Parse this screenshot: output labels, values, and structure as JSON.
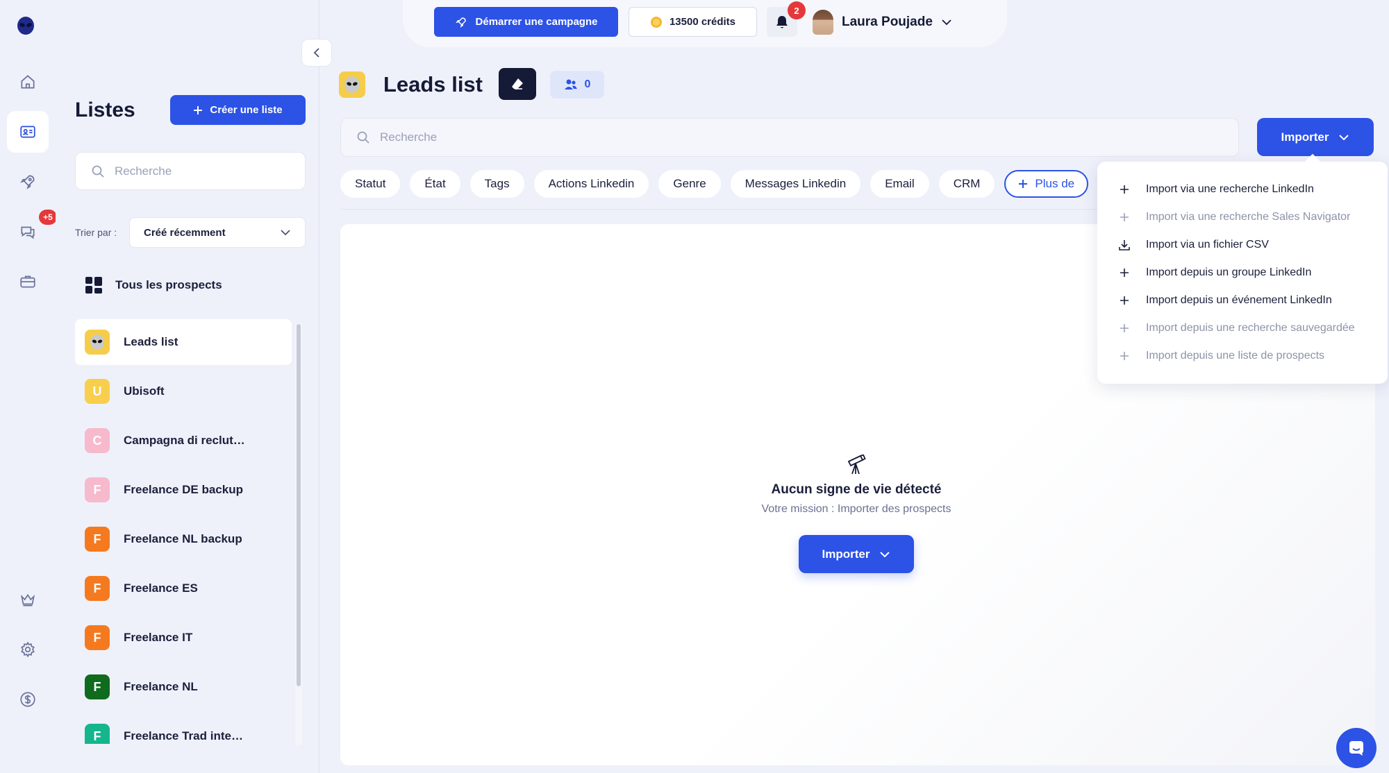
{
  "topbar": {
    "campaign_label": "Démarrer une campagne",
    "credits_label": "13500 crédits",
    "notifications_count": "2",
    "user_name": "Laura Poujade"
  },
  "rail": {
    "items": [
      {
        "icon": "home-icon"
      },
      {
        "icon": "contacts-icon",
        "active": true
      },
      {
        "icon": "rocket-icon"
      },
      {
        "icon": "messages-icon",
        "badge": "+5"
      },
      {
        "icon": "briefcase-icon"
      },
      {
        "icon": "crown-icon"
      },
      {
        "icon": "gear-icon"
      },
      {
        "icon": "dollar-icon"
      }
    ]
  },
  "panel": {
    "title": "Listes",
    "create_label": "Créer une liste",
    "search_placeholder": "Recherche",
    "sort_label": "Trier par :",
    "sort_value": "Créé récemment",
    "all_prospects": "Tous les prospects",
    "lists": [
      {
        "name": "Leads list",
        "letter": "",
        "color": "#f5cd4a",
        "active": true
      },
      {
        "name": "Ubisoft",
        "letter": "U",
        "color": "#f8cf4c"
      },
      {
        "name": "Campagna di reclut…",
        "letter": "C",
        "color": "#f7b9cc"
      },
      {
        "name": "Freelance DE backup",
        "letter": "F",
        "color": "#f7b9cc"
      },
      {
        "name": "Freelance NL backup",
        "letter": "F",
        "color": "#f57a1f"
      },
      {
        "name": "Freelance ES",
        "letter": "F",
        "color": "#f57a1f"
      },
      {
        "name": "Freelance IT",
        "letter": "F",
        "color": "#f57a1f"
      },
      {
        "name": "Freelance NL",
        "letter": "F",
        "color": "#0f6b1d"
      },
      {
        "name": "Freelance Trad inte…",
        "letter": "F",
        "color": "#15b58d"
      }
    ]
  },
  "main": {
    "title": "Leads list",
    "members_count": "0",
    "search_placeholder": "Recherche",
    "import_label": "Importer",
    "filters": [
      "Statut",
      "État",
      "Tags",
      "Actions Linkedin",
      "Genre",
      "Messages Linkedin",
      "Email",
      "CRM"
    ],
    "more_filters_label": "Plus de",
    "empty_title": "Aucun signe de vie détecté",
    "empty_subtitle": "Votre mission : Importer des prospects",
    "empty_import_label": "Importer"
  },
  "import_menu": [
    {
      "label": "Import via une recherche LinkedIn",
      "icon": "plus-icon",
      "enabled": true
    },
    {
      "label": "Import via une recherche Sales Navigator",
      "icon": "plus-icon",
      "enabled": false
    },
    {
      "label": "Import via un fichier CSV",
      "icon": "download-icon",
      "enabled": true
    },
    {
      "label": "Import depuis un groupe LinkedIn",
      "icon": "plus-icon",
      "enabled": true
    },
    {
      "label": "Import depuis un événement LinkedIn",
      "icon": "plus-icon",
      "enabled": true
    },
    {
      "label": "Import depuis une recherche sauvegardée",
      "icon": "plus-icon",
      "enabled": false
    },
    {
      "label": "Import depuis une liste de prospects",
      "icon": "plus-icon",
      "enabled": false
    }
  ],
  "colors": {
    "primary": "#2c52e6",
    "badge": "#e5383b",
    "background": "#eef1fa"
  }
}
